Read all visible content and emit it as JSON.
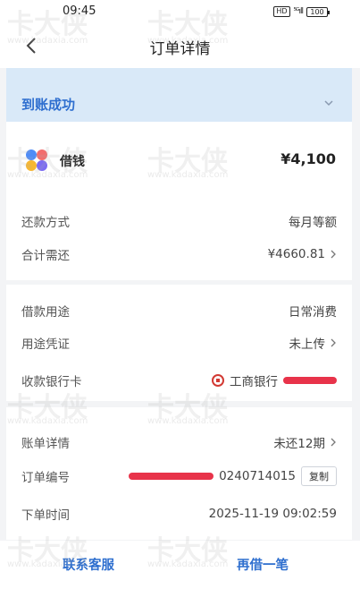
{
  "statusbar": {
    "time": "09:45",
    "hd": "HD",
    "signal": "⁵ᴳıll",
    "battery": "100"
  },
  "nav": {
    "title": "订单详情"
  },
  "status": {
    "text": "到账成功"
  },
  "loan": {
    "name": "借钱",
    "amount": "¥4,100"
  },
  "rows1": [
    {
      "label": "还款方式",
      "value": "每月等额"
    },
    {
      "label": "合计需还",
      "value": "¥4660.81"
    }
  ],
  "rows2": [
    {
      "label": "借款用途",
      "value": "日常消费"
    },
    {
      "label": "用途凭证",
      "value": "未上传"
    },
    {
      "label": "收款银行卡",
      "value": "工商银行"
    }
  ],
  "rows3": [
    {
      "label": "账单详情",
      "value": "未还12期"
    },
    {
      "label": "订单编号",
      "value": "0240714015",
      "copy": "复制"
    },
    {
      "label": "下单时间",
      "value": "2025-11-19 09:02:59"
    }
  ],
  "bottom": {
    "contact": "联系客服",
    "again": "再借一笔"
  },
  "watermark": {
    "text": "卡大侠",
    "url": "www.kadaxia.com"
  },
  "colors": {
    "accent": "#2f6fcf",
    "status_bg": "#d9e9f8",
    "bank_red": "#d23a34"
  }
}
